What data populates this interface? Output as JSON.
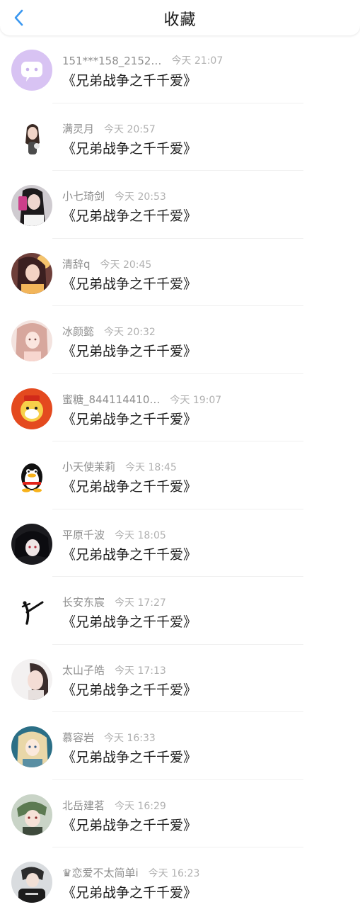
{
  "header": {
    "title": "收藏",
    "back_icon": "chevron-left-icon",
    "accent_color": "#3a97f0"
  },
  "items": [
    {
      "name": "151***158_2152…",
      "time": "今天 21:07",
      "content": "《兄弟战争之千千爱》",
      "avatar": "chat-bubble"
    },
    {
      "name": "满灵月",
      "time": "今天 20:57",
      "content": "《兄弟战争之千千爱》",
      "avatar": "girl-photo"
    },
    {
      "name": "小七琦剑",
      "time": "今天 20:53",
      "content": "《兄弟战争之千千爱》",
      "avatar": "selfie-photo"
    },
    {
      "name": "清辞q",
      "time": "今天 20:45",
      "content": "《兄弟战争之千千爱》",
      "avatar": "anime-girl"
    },
    {
      "name": "冰颜懿",
      "time": "今天 20:32",
      "content": "《兄弟战争之千千爱》",
      "avatar": "anime-girl-light"
    },
    {
      "name": "蜜糖_844114410…",
      "time": "今天 19:07",
      "content": "《兄弟战争之千千爱》",
      "avatar": "cartoon-red"
    },
    {
      "name": "小天使茉莉",
      "time": "今天 18:45",
      "content": "《兄弟战争之千千爱》",
      "avatar": "penguin"
    },
    {
      "name": "平原千波",
      "time": "今天 18:05",
      "content": "《兄弟战争之千千爱》",
      "avatar": "anime-dark"
    },
    {
      "name": "长安东宸",
      "time": "今天 17:27",
      "content": "《兄弟战争之千千爱》",
      "avatar": "ink-figure"
    },
    {
      "name": "太山子皓",
      "time": "今天 17:13",
      "content": "《兄弟战争之千千爱》",
      "avatar": "portrait-light"
    },
    {
      "name": "慕容岩",
      "time": "今天 16:33",
      "content": "《兄弟战争之千千爱》",
      "avatar": "anime-teal"
    },
    {
      "name": "北岳建茗",
      "time": "今天 16:29",
      "content": "《兄弟战争之千千爱》",
      "avatar": "anime-boy-green"
    },
    {
      "name": "♛恋爱不太简单i",
      "time": "今天 16:23",
      "content": "《兄弟战争之千千爱》",
      "avatar": "boy-black-shirt"
    }
  ]
}
